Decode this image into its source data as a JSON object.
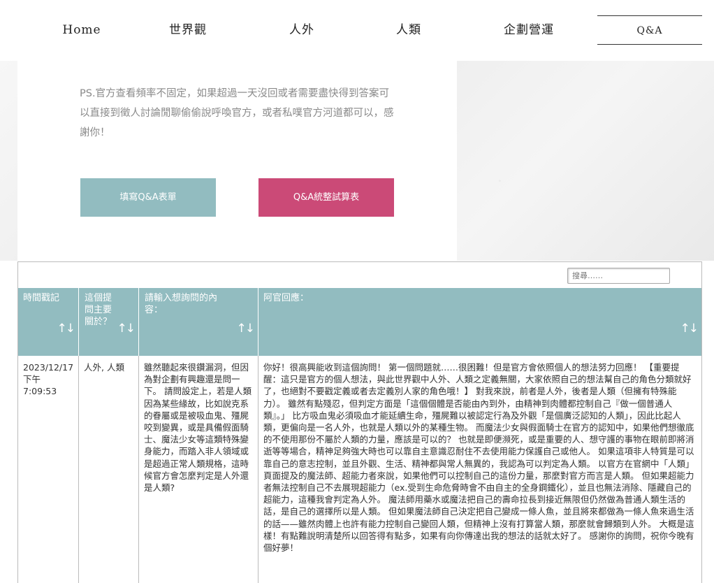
{
  "nav": {
    "items": [
      {
        "label": "Home"
      },
      {
        "label": "世界觀"
      },
      {
        "label": "人外"
      },
      {
        "label": "人類"
      },
      {
        "label": "企劃營運"
      },
      {
        "label": "Q&A"
      }
    ],
    "active": "Q&A"
  },
  "hero": {
    "notice": "PS.官方查看頻率不固定，如果超過一天沒回或者需要盡快得到答案可以直接到徵人討論閒聊偷偷說呼喚官方，或者私噗官方河道都可以，感謝你！",
    "button_form": "填寫Q&A表單",
    "button_table": "Q&A統整試算表"
  },
  "colors": {
    "teal": "#92bcc0",
    "pink": "#cb4a77"
  },
  "table": {
    "search_placeholder": "搜尋……",
    "headers": [
      "時間戳記",
      "這個提問主要關於？",
      "請輸入想詢問的內容：",
      "阿官回應："
    ],
    "sort_icon": "sort-arrows-icon",
    "rows": [
      {
        "timestamp": "2023/12/17 下午 7:09:53",
        "topic": "人外, 人類",
        "question": "雖然聽起來很鑽漏洞，但因為對企劃有興趣還是問一下。 請問設定上，若是人類因為某些緣故，比如說克系的眷屬或是被吸血鬼、殭屍咬到變異，或是具備假面騎士、魔法少女等這類特殊變身能力，而踏入非人領域或是超過正常人類規格，這時候官方會怎麼判定是人外還是人類?",
        "answer": "你好！很高興能收到這個詢問！ 第一個問題就……很困難！但是官方會依照個人的想法努力回應！ 【重要提醒：這只是官方的個人想法，與此世界觀中人外、人類之定義無關，大家依照自己的想法幫自己的角色分類就好了，也絕對不要戳定義或者去定義別人家的角色哦！】 對我來說，前者是人外，後者是人類（但擁有特殊能力）。 雖然有點殘忍，但判定方面是「這個個體是否能由內到外，由精神到肉體都控制自己『做一個普通人類』。」 比方吸血鬼必須吸血才能延續生命，殭屍難以被認定行為及外觀「是個廣泛認知的人類」，因此比起人類，更偏向是一名人外，也就是人類以外的某種生物。 而魔法少女與假面騎士在官方的認知中，如果他們想徹底的不使用那份不屬於人類的力量，應該是可以的？ 也就是即便瀕死，或是重要的人、想守護的事物在眼前即將消逝等等場合，精神足夠強大時也可以靠自主意識忍耐住不去使用能力保護自己或他人。 如果這項非人特質是可以靠自己的意志控制，並且外觀、生活、精神都與常人無異的，我認為可以判定為人類。 以官方在官網中「人類」頁面提及的魔法師、超能力者來說，如果他們可以控制自己的這份力量，那麼對官方而言是人類。 但如果超能力者無法控制自己不去展現超能力（ex.受到生命危脅時會不由自主的全身鋼鐵化），並且也無法消除、隱藏自己的超能力，這種我會判定為人外。 魔法師用藥水或魔法把自己的壽命拉長到接近無限但仍然做為普通人類生活的話，是自己的選擇所以是人類。 但如果魔法師自己決定把自己變成一條人魚，並且將來都做為一條人魚來過生活的話——雖然肉體上也許有能力控制自己變回人類，但精神上沒有打算當人類，那麼就會歸類到人外。 大概是這樣！有點難說明清楚所以回答得有點多，如果有向你傳達出我的想法的話就太好了。 感謝你的詢問，祝你今晚有個好夢！"
      }
    ]
  }
}
